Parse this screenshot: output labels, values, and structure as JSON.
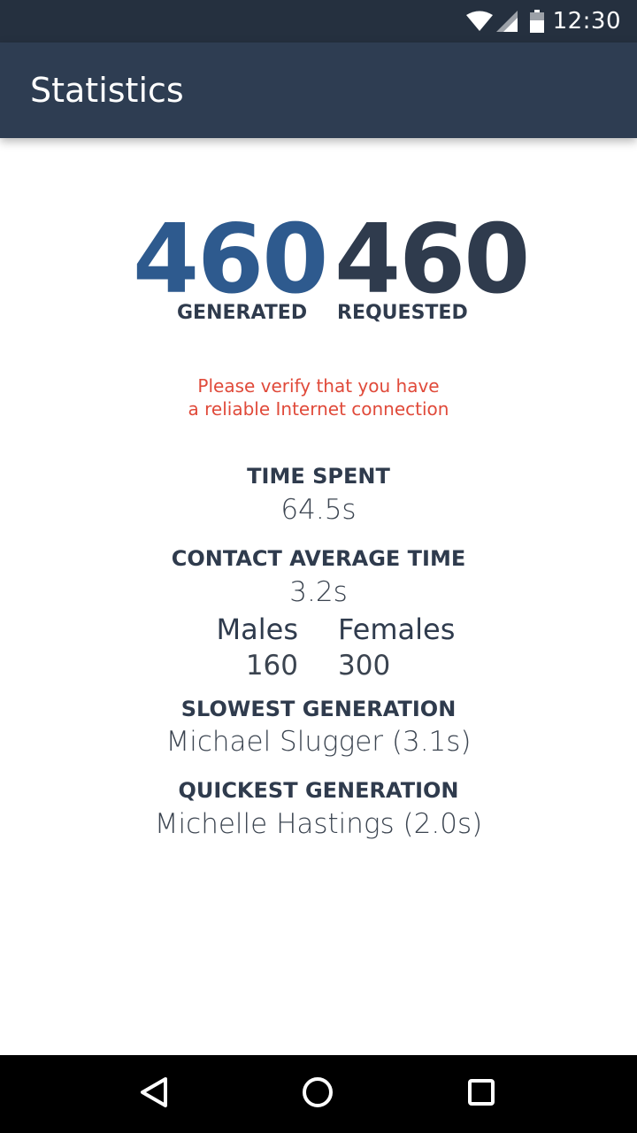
{
  "status_bar": {
    "time": "12:30",
    "icons": [
      "wifi-icon",
      "cell-signal-icon",
      "battery-icon"
    ]
  },
  "app_bar": {
    "title": "Statistics"
  },
  "stats": {
    "generated": {
      "value": "460",
      "label": "GENERATED"
    },
    "requested": {
      "value": "460",
      "label": "REQUESTED"
    }
  },
  "warning": {
    "line1": "Please verify that you have",
    "line2": "a reliable Internet connection"
  },
  "time_spent": {
    "label": "TIME SPENT",
    "value": "64.5s"
  },
  "contact_average": {
    "label": "CONTACT AVERAGE TIME",
    "value": "3.2s"
  },
  "gender": {
    "males_label": "Males",
    "females_label": "Females",
    "males_value": "160",
    "females_value": "300"
  },
  "slowest": {
    "label": "SLOWEST GENERATION",
    "value": "Michael Slugger (3.1s)"
  },
  "quickest": {
    "label": "QUICKEST GENERATION",
    "value": "Michelle Hastings (2.0s)"
  },
  "nav": {
    "buttons": [
      "back-icon",
      "home-icon",
      "recents-icon"
    ]
  },
  "colors": {
    "status_bar": "#25303f",
    "app_bar": "#2e3d52",
    "generated_accent": "#2e5a8e",
    "requested_text": "#2f3b4d",
    "warning": "#e04a3a"
  }
}
